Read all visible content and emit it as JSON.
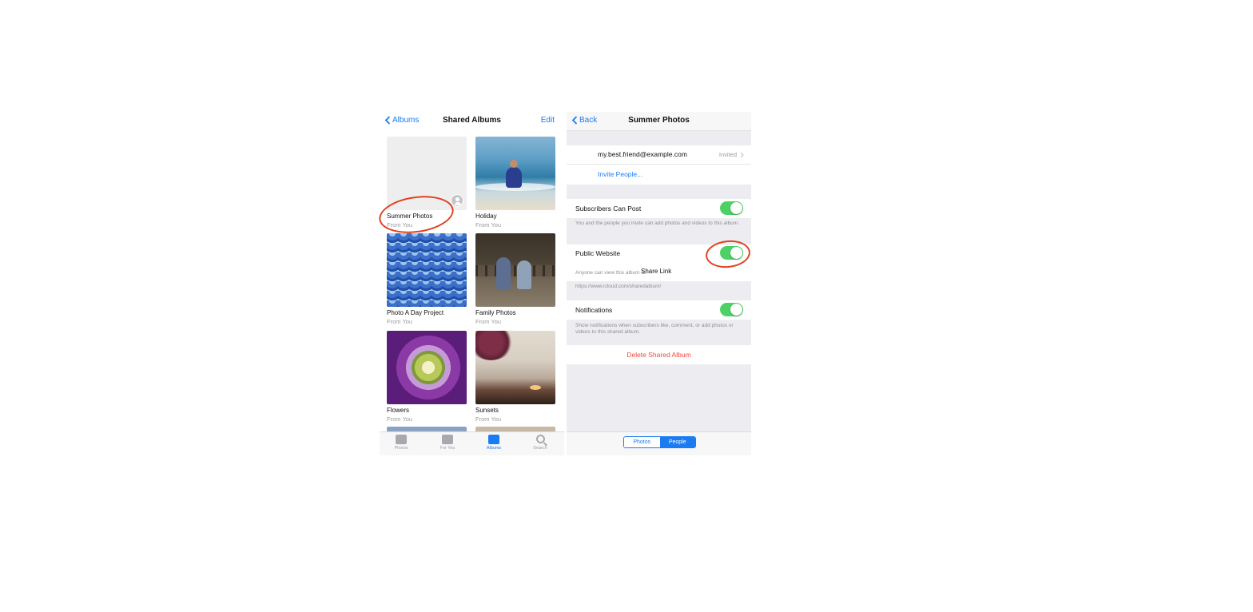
{
  "shared_albums": {
    "nav": {
      "back_label": "Albums",
      "title": "Shared Albums",
      "edit_label": "Edit"
    },
    "albums": [
      {
        "name": "Summer Photos",
        "subtitle": "From You"
      },
      {
        "name": "Holiday",
        "subtitle": "From You"
      },
      {
        "name": "Photo A Day Project",
        "subtitle": "From You"
      },
      {
        "name": "Family Photos",
        "subtitle": "From You"
      },
      {
        "name": "Flowers",
        "subtitle": "From You"
      },
      {
        "name": "Sunsets",
        "subtitle": "From You"
      }
    ],
    "tabs": [
      {
        "label": "Photos",
        "icon": "photos-icon"
      },
      {
        "label": "For You",
        "icon": "for-you-icon"
      },
      {
        "label": "Albums",
        "icon": "albums-icon",
        "active": true
      },
      {
        "label": "Search",
        "icon": "search-icon"
      }
    ]
  },
  "album_settings": {
    "nav": {
      "back_label": "Back",
      "title": "Summer Photos"
    },
    "subscriber": {
      "email": "my.best.friend@example.com",
      "status": "Invited"
    },
    "invite_label": "Invite People...",
    "subscribers_can_post": {
      "label": "Subscribers Can Post",
      "on": true,
      "caption": "You and the people you invite can add photos and videos to this album."
    },
    "public_website": {
      "label": "Public Website",
      "on": true,
      "caption": "Anyone can view this album at:",
      "share_link_label": "Share Link",
      "url": "https://www.icloud.com/sharedalbum/"
    },
    "notifications": {
      "label": "Notifications",
      "on": true,
      "caption": "Show notifications when subscribers like, comment, or add photos or videos to this shared album."
    },
    "delete_label": "Delete Shared Album",
    "segments": [
      {
        "label": "Photos",
        "selected": false
      },
      {
        "label": "People",
        "selected": true
      }
    ]
  },
  "colors": {
    "accent": "#1a7cf0",
    "toggle_on": "#4cd264",
    "destructive": "#f0483b",
    "annotation": "#e2401f"
  }
}
